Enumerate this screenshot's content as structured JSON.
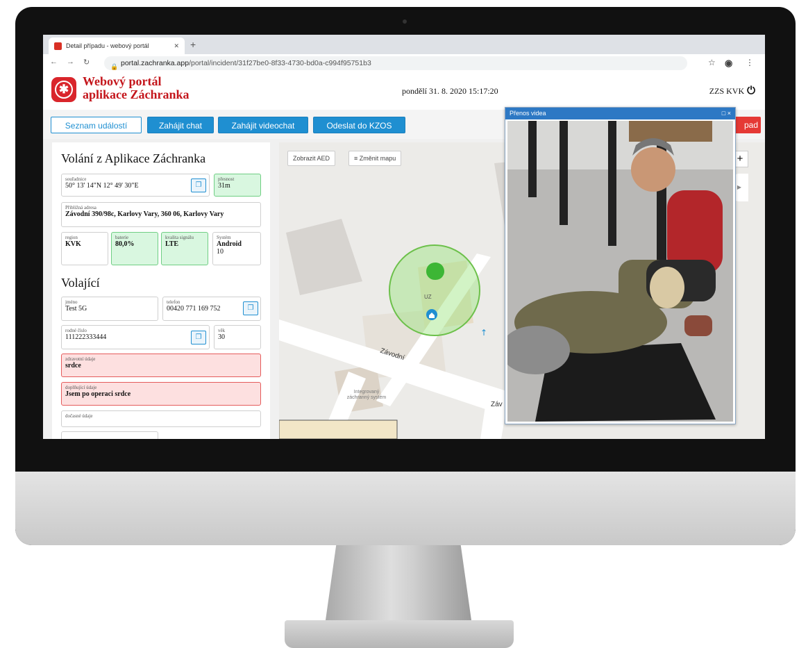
{
  "browser": {
    "tab_title": "Detail případu - webový portál",
    "tab_close": "✕",
    "new_tab": "+",
    "url_host": "portal.zachranka.app",
    "url_path": "/portal/incident/31f27be0-8f33-4730-bd0a-c994f95751b3"
  },
  "header": {
    "brand_line1": "Webový portál",
    "brand_line2": "aplikace Záchranka",
    "datetime": "pondělí 31. 8. 2020 15:17:20",
    "user": "ZZS KVK"
  },
  "toolbar": {
    "events": "Seznam událostí",
    "chat": "Zahájit chat",
    "videochat": "Zahájit videochat",
    "send": "Odeslat do KZOS",
    "red_partial": "pad"
  },
  "call": {
    "title": "Volání z Aplikace Záchranka",
    "coords_label": "souřadnice",
    "coords": "50° 13' 14\"N 12° 49' 30\"E",
    "accuracy_label": "přesnost",
    "accuracy": "31m",
    "address_label": "Přibližná adresa",
    "address": "Závodní 390/98c, Karlovy Vary, 360 06, Karlovy Vary",
    "region_label": "region",
    "region": "KVK",
    "battery_label": "baterie",
    "battery": "80,0%",
    "signal_label": "kvalita signálu",
    "signal": "LTE",
    "system_label": "Systém",
    "system": "Android",
    "system_version": "10"
  },
  "caller": {
    "title": "Volající",
    "name_label": "jméno",
    "name": "Test 5G",
    "phone_label": "telefon",
    "phone": "00420 771 169 752",
    "birth_label": "rodné číslo",
    "birth": "111222333444",
    "age_label": "věk",
    "age": "30",
    "health_label": "zdravotní údaje",
    "health": "srdce",
    "extra_label": "doplňující údaje",
    "extra": "Jsem po operaci srdce",
    "temp_label": "dočasné údaje"
  },
  "map": {
    "aed_button": "Zobrazit AED",
    "change_map_button": "Změnit mapu",
    "street_label": "Závodní",
    "street_label2": "Záv",
    "poi_label": "Integrovaný záchranný systém",
    "pin_label": "UZ",
    "zoom_in": "+"
  },
  "video": {
    "title": "Přenos videa",
    "controls": "□ ×"
  }
}
